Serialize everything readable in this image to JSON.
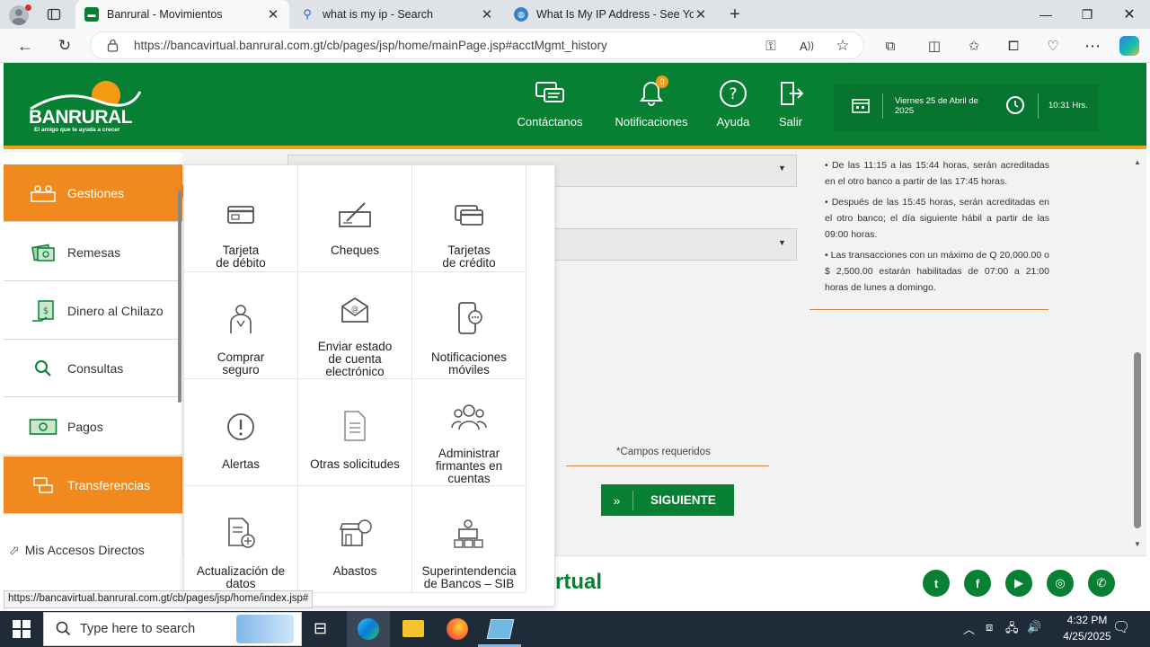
{
  "browser": {
    "tabs": [
      {
        "title": "Banrural - Movimientos",
        "active": true
      },
      {
        "title": "what is my ip - Search",
        "active": false
      },
      {
        "title": "What Is My IP Address - See Your",
        "active": false
      }
    ],
    "url": "https://bancavirtual.banrural.com.gt/cb/pages/jsp/home/mainPage.jsp#acctMgmt_history",
    "status_url": "https://bancavirtual.banrural.com.gt/cb/pages/jsp/home/index.jsp#"
  },
  "header": {
    "brand": "BANRURAL",
    "slogan": "El amigo que te ayuda a crecer",
    "menu": [
      {
        "label": "Contáctanos",
        "icon": "chat-icon"
      },
      {
        "label": "Notificaciones",
        "icon": "bell-icon",
        "badge": "0"
      },
      {
        "label": "Ayuda",
        "icon": "help-icon"
      },
      {
        "label": "Salir",
        "icon": "exit-icon"
      }
    ],
    "date": "Viernes 25 de Abril de 2025",
    "time": "10:31 Hrs."
  },
  "sidebar": {
    "items": [
      {
        "label": "Gestiones",
        "active": true
      },
      {
        "label": "Remesas"
      },
      {
        "label": "Dinero al Chilazo"
      },
      {
        "label": "Consultas"
      },
      {
        "label": "Pagos"
      },
      {
        "label": "Transferencias",
        "active": true
      }
    ],
    "shortcuts": "Mis Accesos Directos"
  },
  "gestiones": [
    {
      "label": "Tarjeta\nde débito",
      "icon": "debit-card-icon"
    },
    {
      "label": "Cheques",
      "icon": "cheque-icon"
    },
    {
      "label": "Tarjetas\nde crédito",
      "icon": "credit-card-icon"
    },
    {
      "label": "Comprar\nseguro",
      "icon": "insurance-icon"
    },
    {
      "label": "Enviar estado\nde cuenta\nelectrónico",
      "icon": "email-statement-icon"
    },
    {
      "label": "Notificaciones\nmóviles",
      "icon": "mobile-notification-icon"
    },
    {
      "label": "Alertas",
      "icon": "alert-icon"
    },
    {
      "label": "Otras solicitudes",
      "icon": "document-icon"
    },
    {
      "label": "Administrar\nfirmantes en\ncuentas",
      "icon": "users-icon"
    },
    {
      "label": "Actualización de\ndatos",
      "icon": "update-data-icon"
    },
    {
      "label": "Abastos",
      "icon": "store-icon"
    },
    {
      "label": "Superintendencia\nde Bancos – SIB",
      "icon": "sib-icon"
    }
  ],
  "content": {
    "notes": [
      "De las 11:15 a las 15:44 horas, serán acreditadas en el otro banco a partir de las 17:45 horas.",
      "Después de las 15:45 horas, serán acreditadas en el otro banco; el día siguiente hábil a partir de las 09:00 horas.",
      "Las transacciones con un máximo de Q 20,000.00 o $ 2,500.00 estarán habilitadas de 07:00 a 21:00 horas de lunes a domingo."
    ],
    "required": "*Campos requeridos",
    "next_button": "SIGUIENTE",
    "footer_brand": "rtual"
  },
  "taskbar": {
    "search_placeholder": "Type here to search",
    "time": "4:32 PM",
    "date": "4/25/2025"
  },
  "colors": {
    "green": "#078034",
    "orange": "#f08a1e",
    "gold": "#e8a317"
  }
}
